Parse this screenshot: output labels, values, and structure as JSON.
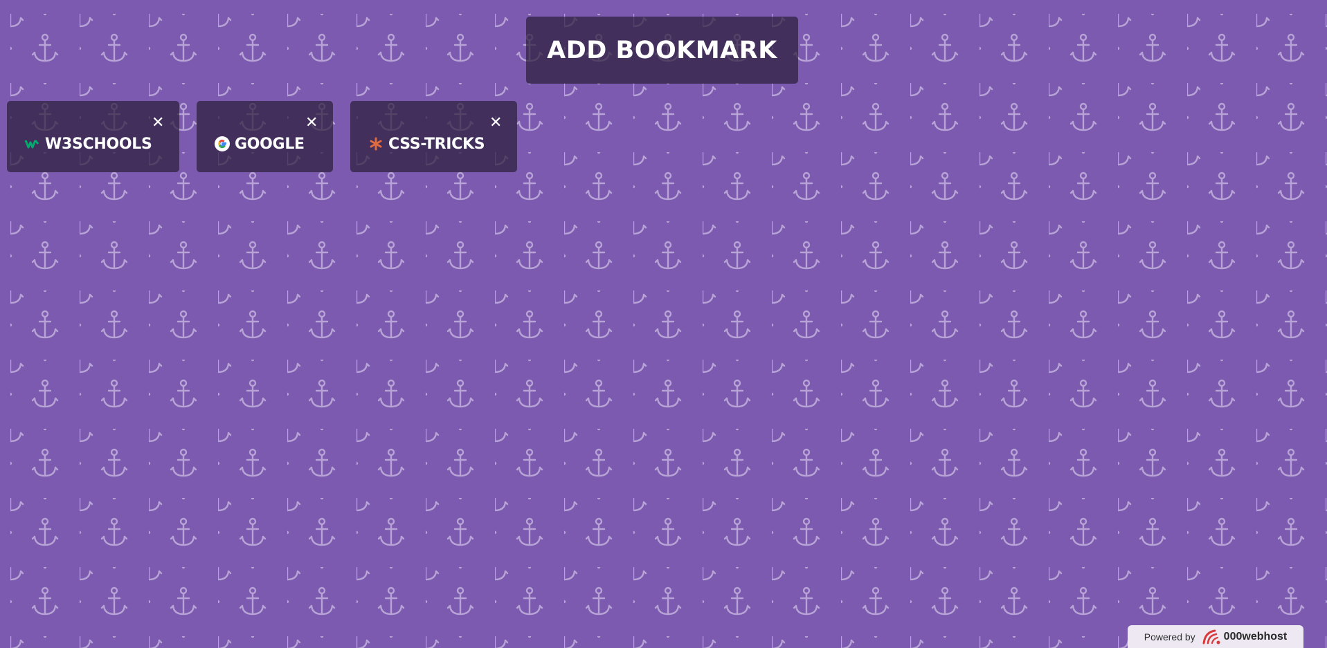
{
  "page": {
    "background_color": "#7b5aaf",
    "pattern_icon": "anchor-icon",
    "pattern_color": "#b8a3d6"
  },
  "header": {
    "add_bookmark_label": "ADD BOOKMARK"
  },
  "bookmarks": [
    {
      "label": "W3SCHOOLS",
      "favicon": "w3schools-icon",
      "favicon_color": "#04aa6d",
      "close_glyph": "✕"
    },
    {
      "label": "GOOGLE",
      "favicon": "google-icon",
      "favicon_color": "#4285f4",
      "close_glyph": "✕"
    },
    {
      "label": "CSS-TRICKS",
      "favicon": "css-tricks-icon",
      "favicon_color": "#e06b3f",
      "close_glyph": "✕"
    }
  ],
  "footer": {
    "powered_label": "Powered by",
    "brand_label": "000webhost",
    "brand_color": "#d93b3b"
  }
}
